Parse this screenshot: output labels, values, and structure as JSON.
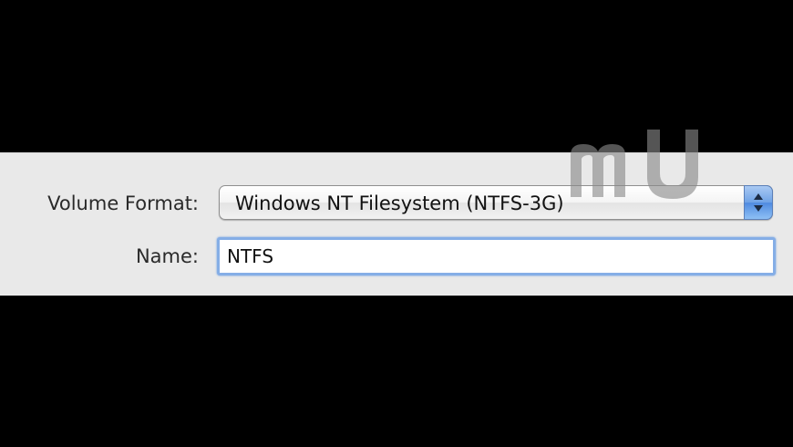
{
  "form": {
    "volume_format_label": "Volume Format:",
    "volume_format_value": "Windows NT Filesystem (NTFS-3G)",
    "name_label": "Name:",
    "name_value": "NTFS"
  },
  "watermark": {
    "icon": "macupdate-logo-watermark",
    "color": "#8a8a8a"
  },
  "colors": {
    "background": "#000000",
    "panel": "#e9e9e9",
    "focus_ring": "#85aee6",
    "stepper": "#6fa2e6"
  }
}
